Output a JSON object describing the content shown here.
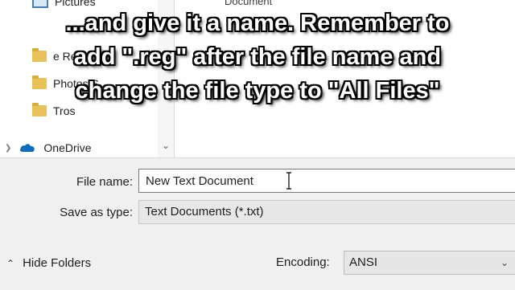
{
  "nav": {
    "items": [
      {
        "label": "Pictures",
        "icon": "pictures-icon"
      },
      {
        "label": "e Re",
        "icon": "folder-icon"
      },
      {
        "label": "Photos S",
        "icon": "folder-icon"
      },
      {
        "label": "Tros",
        "icon": "folder-icon"
      },
      {
        "label": "OneDrive",
        "icon": "onedrive-icon"
      }
    ]
  },
  "content": {
    "partial_label": "Document"
  },
  "form": {
    "file_name_label": "File name:",
    "file_name_value": "New Text Document",
    "save_as_type_label": "Save as type:",
    "save_as_type_value": "Text Documents (*.txt)"
  },
  "footer": {
    "hide_folders_label": "Hide Folders",
    "encoding_label": "Encoding:",
    "encoding_value": "ANSI"
  },
  "caption": {
    "text": "...and give it a name. Remember to\nadd \".reg\" after the file name and\nchange the file type to \"All Files\""
  },
  "colors": {
    "folder": "#e8c15a",
    "onedrive": "#0f6cbd",
    "dialog_bg": "#f0f0f0"
  }
}
